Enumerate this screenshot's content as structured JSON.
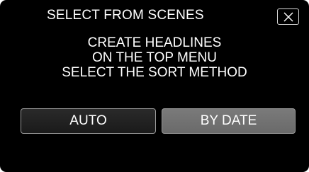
{
  "dialog": {
    "title": "SELECT FROM SCENES",
    "close_icon": "close-x-icon",
    "message_lines": [
      "CREATE HEADLINES",
      "ON THE TOP MENU",
      "SELECT THE SORT METHOD"
    ]
  },
  "options": [
    {
      "label": "AUTO",
      "selected": false
    },
    {
      "label": "BY DATE",
      "selected": true
    }
  ],
  "colors": {
    "background": "#000000",
    "text": "#ffffff",
    "button_default": "#222222",
    "button_selected": "#707070",
    "button_border": "#9a9a9a"
  }
}
